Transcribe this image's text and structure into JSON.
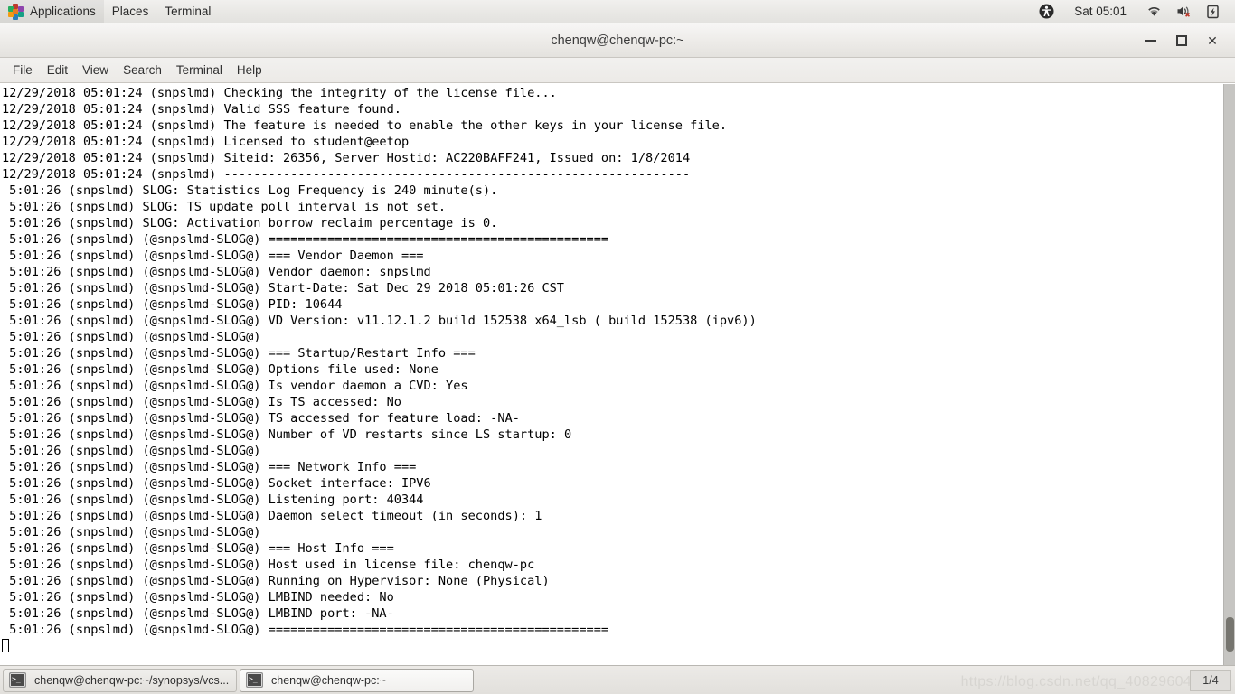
{
  "top_panel": {
    "apps_label": "Applications",
    "places_label": "Places",
    "terminal_label": "Terminal",
    "clock": "Sat 05:01",
    "tray": {
      "accessibility_icon": "accessibility-icon",
      "wifi_icon": "wifi-icon",
      "volume_icon": "volume-muted-icon",
      "battery_icon": "battery-charging-icon"
    }
  },
  "window": {
    "title": "chenqw@chenqw-pc:~",
    "buttons": {
      "minimize": "minimize-button",
      "maximize": "maximize-button",
      "close": "✕"
    },
    "menubar": [
      "File",
      "Edit",
      "View",
      "Search",
      "Terminal",
      "Help"
    ]
  },
  "terminal": {
    "lines": [
      "12/29/2018 05:01:24 (snpslmd) Checking the integrity of the license file...",
      "12/29/2018 05:01:24 (snpslmd) Valid SSS feature found.",
      "12/29/2018 05:01:24 (snpslmd) The feature is needed to enable the other keys in your license file.",
      "12/29/2018 05:01:24 (snpslmd) Licensed to student@eetop",
      "12/29/2018 05:01:24 (snpslmd) Siteid: 26356, Server Hostid: AC220BAFF241, Issued on: 1/8/2014",
      "12/29/2018 05:01:24 (snpslmd) ---------------------------------------------------------------",
      " 5:01:26 (snpslmd) SLOG: Statistics Log Frequency is 240 minute(s).",
      " 5:01:26 (snpslmd) SLOG: TS update poll interval is not set.",
      " 5:01:26 (snpslmd) SLOG: Activation borrow reclaim percentage is 0.",
      " 5:01:26 (snpslmd) (@snpslmd-SLOG@) ==============================================",
      " 5:01:26 (snpslmd) (@snpslmd-SLOG@) === Vendor Daemon ===",
      " 5:01:26 (snpslmd) (@snpslmd-SLOG@) Vendor daemon: snpslmd",
      " 5:01:26 (snpslmd) (@snpslmd-SLOG@) Start-Date: Sat Dec 29 2018 05:01:26 CST",
      " 5:01:26 (snpslmd) (@snpslmd-SLOG@) PID: 10644",
      " 5:01:26 (snpslmd) (@snpslmd-SLOG@) VD Version: v11.12.1.2 build 152538 x64_lsb ( build 152538 (ipv6))",
      " 5:01:26 (snpslmd) (@snpslmd-SLOG@)",
      " 5:01:26 (snpslmd) (@snpslmd-SLOG@) === Startup/Restart Info ===",
      " 5:01:26 (snpslmd) (@snpslmd-SLOG@) Options file used: None",
      " 5:01:26 (snpslmd) (@snpslmd-SLOG@) Is vendor daemon a CVD: Yes",
      " 5:01:26 (snpslmd) (@snpslmd-SLOG@) Is TS accessed: No",
      " 5:01:26 (snpslmd) (@snpslmd-SLOG@) TS accessed for feature load: -NA-",
      " 5:01:26 (snpslmd) (@snpslmd-SLOG@) Number of VD restarts since LS startup: 0",
      " 5:01:26 (snpslmd) (@snpslmd-SLOG@)",
      " 5:01:26 (snpslmd) (@snpslmd-SLOG@) === Network Info ===",
      " 5:01:26 (snpslmd) (@snpslmd-SLOG@) Socket interface: IPV6",
      " 5:01:26 (snpslmd) (@snpslmd-SLOG@) Listening port: 40344",
      " 5:01:26 (snpslmd) (@snpslmd-SLOG@) Daemon select timeout (in seconds): 1",
      " 5:01:26 (snpslmd) (@snpslmd-SLOG@)",
      " 5:01:26 (snpslmd) (@snpslmd-SLOG@) === Host Info ===",
      " 5:01:26 (snpslmd) (@snpslmd-SLOG@) Host used in license file: chenqw-pc",
      " 5:01:26 (snpslmd) (@snpslmd-SLOG@) Running on Hypervisor: None (Physical)",
      " 5:01:26 (snpslmd) (@snpslmd-SLOG@) LMBIND needed: No",
      " 5:01:26 (snpslmd) (@snpslmd-SLOG@) LMBIND port: -NA-",
      " 5:01:26 (snpslmd) (@snpslmd-SLOG@) =============================================="
    ]
  },
  "bottom_panel": {
    "tasks": [
      {
        "label": "chenqw@chenqw-pc:~/synopsys/vcs...",
        "active": false
      },
      {
        "label": "chenqw@chenqw-pc:~",
        "active": true
      }
    ],
    "watermark": "https://blog.csdn.net/qq_40829604",
    "workspace": "1/4"
  },
  "colors": {
    "panel_bg": "#e9e8e5",
    "terminal_bg": "#ffffff",
    "terminal_fg": "#000000",
    "scrollbar_track": "#c6c5c2",
    "scrollbar_thumb": "#76756f"
  }
}
